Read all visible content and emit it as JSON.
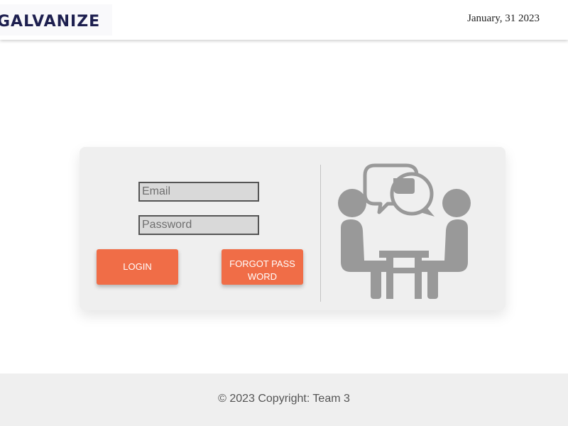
{
  "header": {
    "logo_text": "GALVANIZE",
    "date": "January, 31 2023"
  },
  "login_form": {
    "email_placeholder": "Email",
    "password_placeholder": "Password",
    "login_label": "LOGIN",
    "forgot_label": "FORGOT PASSWORD"
  },
  "illustration": {
    "icon": "meeting-conversation-icon",
    "color": "#999999"
  },
  "footer": {
    "copyright": "© 2023 Copyright: Team 3"
  },
  "colors": {
    "accent": "#f06d47",
    "card_bg": "#efefef",
    "footer_bg": "#efefef",
    "logo": "#1d1f4f"
  }
}
